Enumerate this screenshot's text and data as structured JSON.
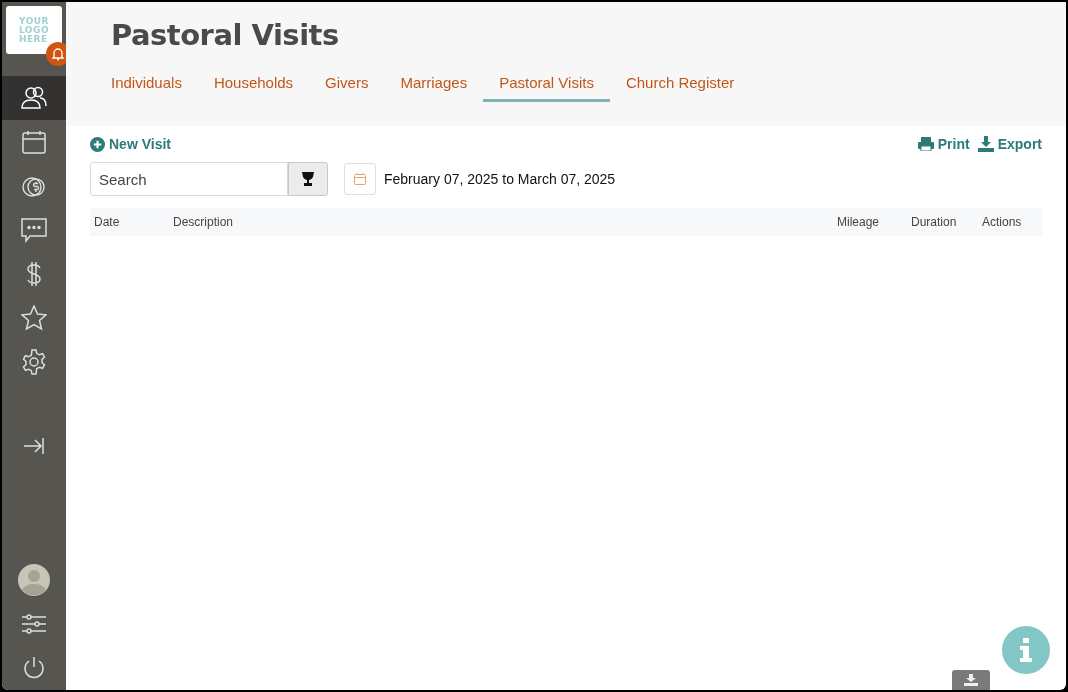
{
  "logo": {
    "lines": [
      "YOUR",
      "LOGO",
      "HERE"
    ]
  },
  "sidebar": {
    "items": [
      {
        "kind": "people",
        "selected": true
      },
      {
        "kind": "calendar",
        "selected": false
      },
      {
        "kind": "coins",
        "selected": false
      },
      {
        "kind": "chat",
        "selected": false
      },
      {
        "kind": "dollar",
        "selected": false
      },
      {
        "kind": "star",
        "selected": false
      },
      {
        "kind": "gear",
        "selected": false
      }
    ]
  },
  "page": {
    "title": "Pastoral Visits"
  },
  "tabs": [
    {
      "label": "Individuals",
      "selected": false
    },
    {
      "label": "Households",
      "selected": false
    },
    {
      "label": "Givers",
      "selected": false
    },
    {
      "label": "Marriages",
      "selected": false
    },
    {
      "label": "Pastoral Visits",
      "selected": true
    },
    {
      "label": "Church Register",
      "selected": false
    }
  ],
  "toolbar": {
    "new_button": "New Visit",
    "print": "Print",
    "export": "Export"
  },
  "search": {
    "placeholder": "Search"
  },
  "date_range": "February 07, 2025 to March 07, 2025",
  "table": {
    "columns": [
      "Date",
      "Description",
      "Mileage",
      "Duration",
      "Actions"
    ]
  }
}
